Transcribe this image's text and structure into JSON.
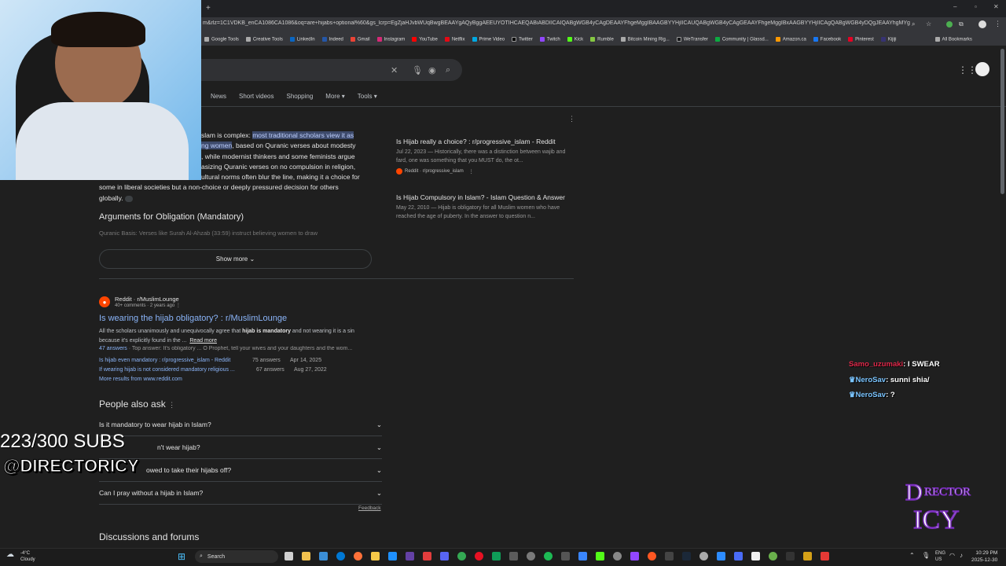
{
  "browser": {
    "url_fragment": "m&rlz=1C1VDKB_enCA1086CA1086&oq=are+hijabs+optional%60&gs_lcrp=EgZjaHJvbWUqBwgBEAAYgAQyBggAEEUYOTIHCAEQABiABDIICAIQABgWGB4yCAgDEAAYFhgeMggIBAAGBYYHjIICAUQABgWGB4yCAgGEAAYFhgeMggIBxAAGBYYHjIICAgQABgWGB4yDQgJEAAYhgMYgAQYigXSA...",
    "bookmarks": [
      "Google Tools",
      "Creative Tools",
      "LinkedIn",
      "Indeed",
      "Gmail",
      "Instagram",
      "YouTube",
      "Netflix",
      "Prime Video",
      "Twitter",
      "Twitch",
      "Kick",
      "Rumble",
      "Bitcoin Mining Rig...",
      "WeTransfer",
      "Community | Glassd...",
      "Amazon.ca",
      "Facebook",
      "Pinterest",
      "Kijiji",
      "All Bookmarks"
    ]
  },
  "search": {
    "tabs": [
      "News",
      "Short videos",
      "Shopping",
      "More",
      "Tools"
    ]
  },
  "overview": {
    "text_a": "slam is complex: ",
    "highlight_a": "most traditional scholars view it as",
    "text_b": "",
    "highlight_b": "ng women",
    "text_c": ", based on Quranic verses about modesty",
    "line3": ", while modernist thinkers and some feminists argue",
    "line4": "asizing Quranic verses on no compulsion in religion,",
    "line5": "ultural norms often blur the line, making it a choice for",
    "line6": "some in liberal societies but a non-choice or deeply pressured decision for others",
    "line7": "globally.",
    "args_title": "Arguments for Obligation (Mandatory)",
    "args_item": "Quranic Basis: Verses like Surah Al-Ahzab (33:59) instruct believing women to draw",
    "show_more": "Show more"
  },
  "side_results": [
    {
      "title": "Is Hijab really a choice? : r/progressive_islam - Reddit",
      "snippet": "Jul 22, 2023 — Historically, there was a distinction between wajib and fard, one was something that you MUST do, the ot...",
      "source": "Reddit · r/progressive_islam"
    },
    {
      "title": "Is Hijab Compulsory in Islam? - Islam Question & Answer",
      "snippet": "May 22, 2010 — Hijab is obligatory for all Muslim women who have reached the age of puberty. In the answer to question n..."
    }
  ],
  "result": {
    "source": "Reddit · r/MuslimLounge",
    "meta": "40+ comments · 2 years ago",
    "title": "Is wearing the hijab obligatory? : r/MuslimLounge",
    "snippet_a": "All the scholars unanimously and unequivocally agree that ",
    "snippet_bold1": "hijab is mandatory",
    "snippet_b": " and not wearing it is a sin",
    "snippet_c": "because it's explicitly found in the ...",
    "read_more": "Read more",
    "answers": "47 answers",
    "answers_rest": " · Top answer: It's obligatory ... O Prophet, tell your wives and your daughters and the wom...",
    "sub1_title": "Is hijab even mandatory : r/progressive_islam - Reddit",
    "sub1_count": "75 answers",
    "sub1_date": "Apr 14, 2025",
    "sub2_title": "If wearing hijab is not considered mandatory religious ...",
    "sub2_count": "67 answers",
    "sub2_date": "Aug 27, 2022",
    "more_results": "More results from www.reddit.com"
  },
  "paa": {
    "title": "People also ask",
    "q1": "Is it mandatory to wear hijab in Islam?",
    "q2": "n't wear hijab?",
    "q3": "owed to take their hijabs off?",
    "q4": "Can I pray without a hijab in Islam?",
    "feedback": "Feedback"
  },
  "discussions": "Discussions and forums",
  "overlay": {
    "subs": "223/300 SUBS",
    "handle": "@DIRECTORICY",
    "chat": [
      {
        "user": "Samo_uzumaki",
        "msg": ": I SWEAR",
        "color": "#e0284a"
      },
      {
        "user": "NeroSav",
        "msg": ": sunni shia/",
        "color": "#7ac4ff"
      },
      {
        "user": "NeroSav",
        "msg": ": ?",
        "color": "#7ac4ff"
      }
    ]
  },
  "taskbar": {
    "weather_temp": "-4°C",
    "weather_desc": "Cloudy",
    "search": "Search",
    "lang1": "ENG",
    "lang2": "US",
    "time": "10:29 PM",
    "date": "2025-12-30"
  }
}
